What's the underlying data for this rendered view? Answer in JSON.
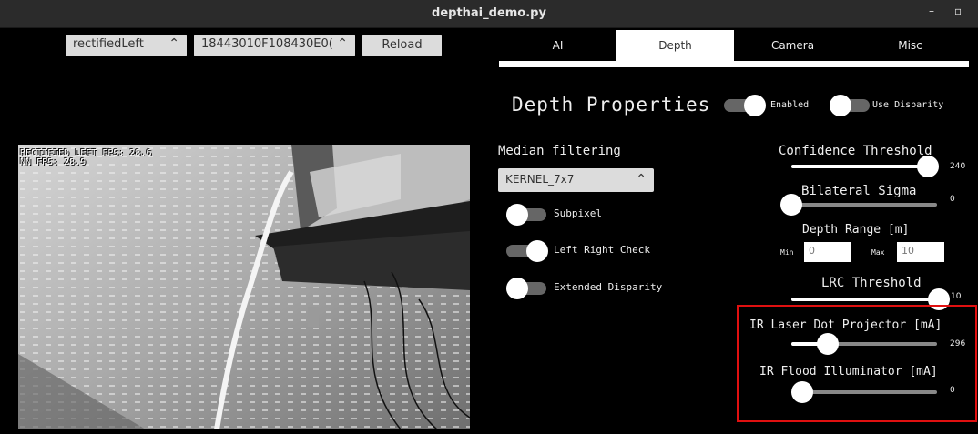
{
  "window": {
    "title": "depthai_demo.py",
    "minimize": "–",
    "maximize": "▫"
  },
  "toolbar": {
    "source_select": "rectifiedLeft",
    "device_select": "18443010F108430E0(",
    "reload_label": "Reload",
    "updown_icon": "⌃⌄"
  },
  "preview": {
    "fps_line": "RECTIFIED LEFT FPS: 28.6",
    "nn_line": "NN FPS:  28.9"
  },
  "tabs": [
    "AI",
    "Depth",
    "Camera",
    "Misc"
  ],
  "active_tab": "Depth",
  "depth": {
    "heading": "Depth Properties",
    "enabled_label": "Enabled",
    "enabled": true,
    "use_disparity_label": "Use Disparity",
    "use_disparity": true,
    "median_label": "Median filtering",
    "median_value": "KERNEL_7x7",
    "subpixel_label": "Subpixel",
    "subpixel": false,
    "lr_check_label": "Left Right Check",
    "lr_check": true,
    "extended_label": "Extended Disparity",
    "extended": false,
    "confidence_label": "Confidence Threshold",
    "confidence_value": "240",
    "confidence_level": 0.94,
    "bilateral_label": "Bilateral Sigma",
    "bilateral_value": "0",
    "bilateral_level": 0.0,
    "range_label": "Depth Range [m]",
    "range_min_label": "Min",
    "range_min_value": "0",
    "range_max_label": "Max",
    "range_max_value": "10",
    "lrc_label": "LRC Threshold",
    "lrc_value": "10",
    "lrc_level": 1.0,
    "laser_label": "IR Laser Dot Projector [mA]",
    "laser_value": "296",
    "laser_level": 0.25,
    "flood_label": "IR Flood Illuminator [mA]",
    "flood_value": "0",
    "flood_level": 0.0
  },
  "colors": {
    "highlight": "#e01010",
    "panel_bg": "#000000",
    "active_tab": "#ffffff"
  }
}
